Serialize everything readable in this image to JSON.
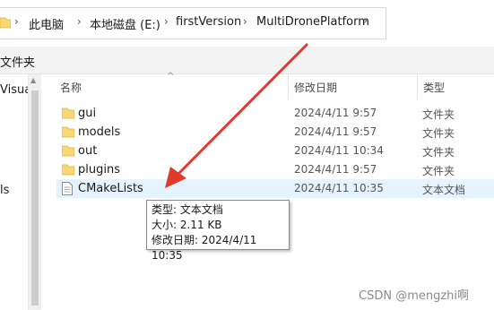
{
  "breadcrumb": {
    "items": [
      "此电脑",
      "本地磁盘 (E:)",
      "firstVersion",
      "MultiDronePlatform"
    ],
    "separator": "›"
  },
  "subbar": {
    "label": "文件夹"
  },
  "nav": {
    "items": [
      "Visual",
      "ls"
    ]
  },
  "columns": {
    "name": "名称",
    "date": "修改日期",
    "type": "类型"
  },
  "files": [
    {
      "name": "gui",
      "date": "2024/4/11 9:57",
      "type": "文件夹",
      "icon": "folder-icon"
    },
    {
      "name": "models",
      "date": "2024/4/11 9:57",
      "type": "文件夹",
      "icon": "folder-icon"
    },
    {
      "name": "out",
      "date": "2024/4/11 10:34",
      "type": "文件夹",
      "icon": "folder-icon"
    },
    {
      "name": "plugins",
      "date": "2024/4/11 9:57",
      "type": "文件夹",
      "icon": "folder-icon"
    },
    {
      "name": "CMakeLists",
      "date": "2024/4/11 10:35",
      "type": "文本文档",
      "icon": "text-file-icon"
    }
  ],
  "tooltip": {
    "type_line": "类型: 文本文档",
    "size_line": "大小: 2.11 KB",
    "date_line": "修改日期: 2024/4/11 10:35"
  },
  "watermark": "CSDN @mengzhi啊",
  "colors": {
    "folder": "#f8d775",
    "folder_dark": "#e0b240",
    "arrow": "#e03a2f",
    "selected": "#e5f3ff"
  }
}
